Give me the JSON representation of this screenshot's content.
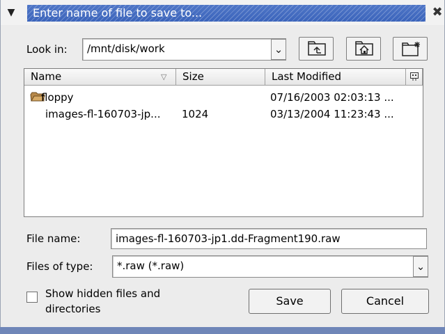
{
  "window": {
    "title": "Enter name of file to save to...",
    "close_glyph": "✖",
    "menu_glyph": "▼"
  },
  "look_in": {
    "label": "Look in:",
    "value": "/mnt/disk/work"
  },
  "file_list": {
    "columns": [
      "Name",
      "Size",
      "Last Modified"
    ],
    "sort_glyph": "▽",
    "rows": [
      {
        "icon": "folder-icon",
        "name": "floppy",
        "size": "",
        "modified": "07/16/2003 02:03:13 ..."
      },
      {
        "icon": "",
        "name": "images-fl-160703-jp...",
        "size": "1024",
        "modified": "03/13/2004 11:23:43 ..."
      }
    ]
  },
  "file_name": {
    "label": "File name:",
    "value": "images-fl-160703-jp1.dd-Fragment190.raw"
  },
  "files_of_type": {
    "label": "Files of type:",
    "value": "*.raw (*.raw)"
  },
  "options": {
    "show_hidden_label_1": "Show hidden files and",
    "show_hidden_label_2": "directories",
    "show_hidden_checked": false
  },
  "buttons": {
    "save": "Save",
    "cancel": "Cancel"
  },
  "colors": {
    "title_bar": "#4a70c3",
    "dialog_bg": "#ececec",
    "desktop": "#6f86b8"
  }
}
